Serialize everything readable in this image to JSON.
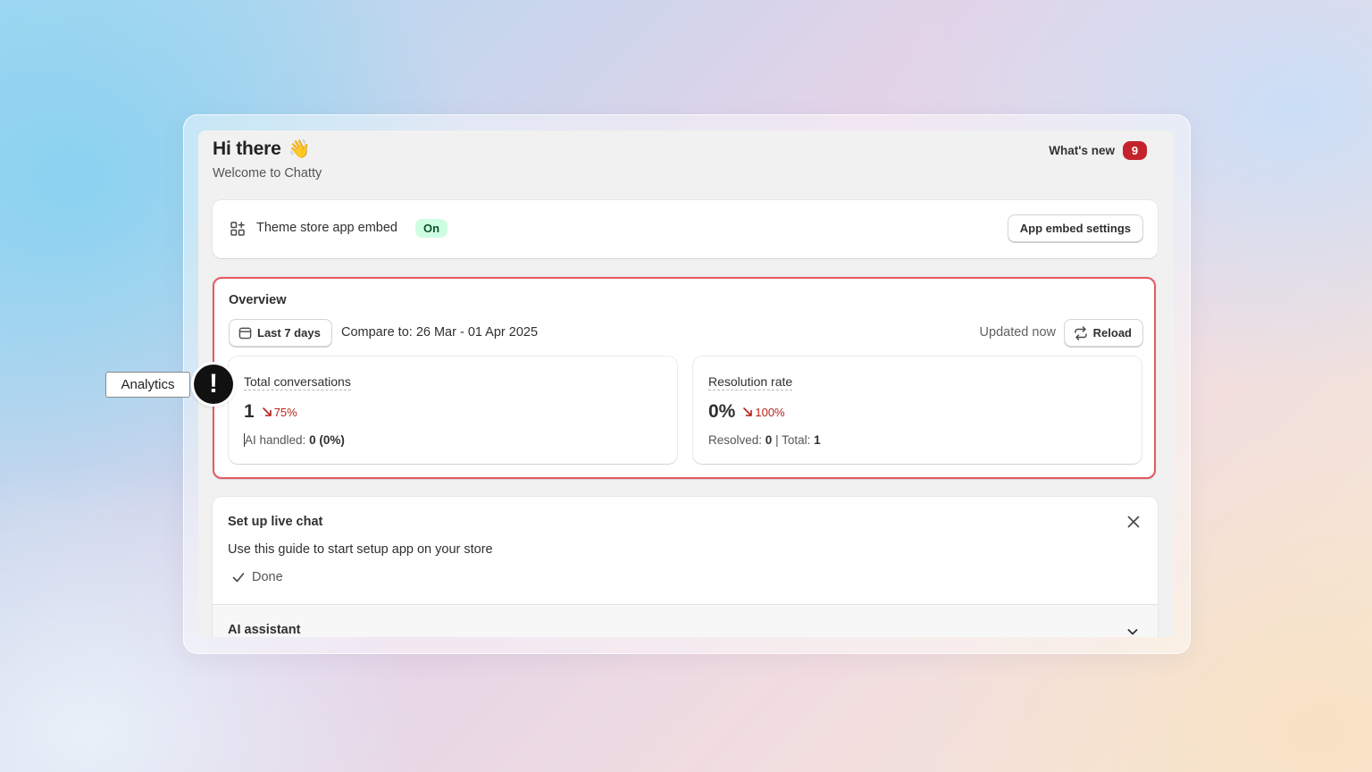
{
  "header": {
    "greeting": "Hi there",
    "wave_emoji": "👋",
    "subtitle": "Welcome to Chatty",
    "whats_new_label": "What's new",
    "whats_new_count": "9"
  },
  "embed": {
    "label": "Theme store app embed",
    "status": "On",
    "settings_button": "App embed settings"
  },
  "overview": {
    "title": "Overview",
    "date_range_button": "Last 7 days",
    "compare_text": "Compare to: 26 Mar - 01 Apr 2025",
    "updated_text": "Updated now",
    "reload_button": "Reload",
    "metrics": [
      {
        "label": "Total conversations",
        "value": "1",
        "delta": "75%",
        "delta_direction": "down",
        "footer_label": "AI handled: ",
        "footer_value": "0 (0%)"
      },
      {
        "label": "Resolution rate",
        "value": "0%",
        "delta": "100%",
        "delta_direction": "down",
        "footer_resolved_label": "Resolved: ",
        "footer_resolved_value": "0",
        "footer_sep": " | Total: ",
        "footer_total_value": "1"
      }
    ]
  },
  "setup": {
    "title": "Set up live chat",
    "description": "Use this guide to start setup app on your store",
    "done_label": "Done",
    "ai_assistant_title": "AI assistant"
  },
  "annotation": {
    "tag_label": "Analytics",
    "alert_symbol": "!"
  },
  "colors": {
    "delta_negative": "#b42318",
    "badge_red": "#c5232c",
    "on_pill_bg": "#cdfee1",
    "highlight_border": "#e55a60"
  },
  "icons": {
    "embed": "apps-grid-icon",
    "calendar": "calendar-icon",
    "reload": "refresh-icon",
    "delta": "arrow-down-right-icon",
    "close": "close-icon",
    "done": "checkmark-icon",
    "expand": "chevron-down-icon",
    "alert": "exclamation-icon"
  }
}
